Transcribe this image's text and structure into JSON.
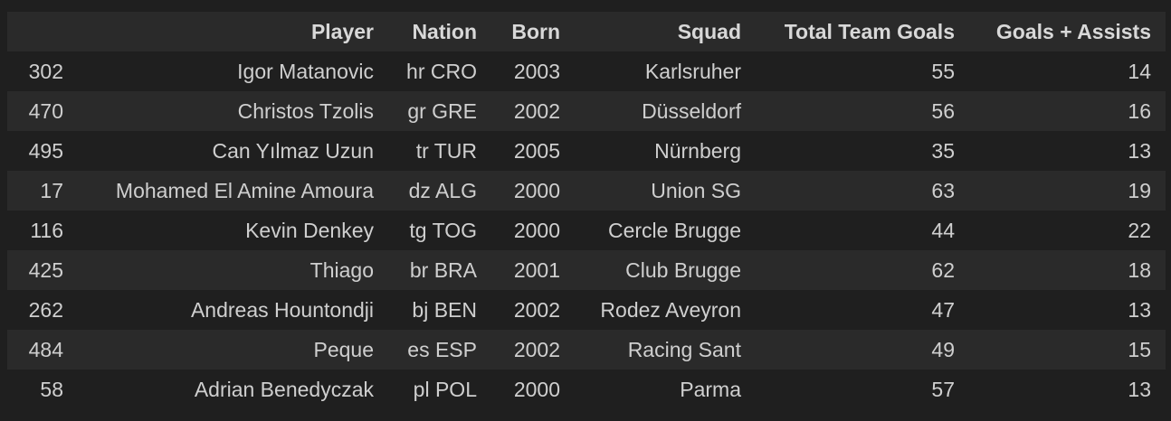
{
  "table": {
    "headers": [
      "",
      "Player",
      "Nation",
      "Born",
      "Squad",
      "Total Team Goals",
      "Goals + Assists"
    ],
    "rows": [
      [
        "302",
        "Igor Matanovic",
        "hr CRO",
        "2003",
        "Karlsruher",
        "55",
        "14"
      ],
      [
        "470",
        "Christos Tzolis",
        "gr GRE",
        "2002",
        "Düsseldorf",
        "56",
        "16"
      ],
      [
        "495",
        "Can Yılmaz Uzun",
        "tr TUR",
        "2005",
        "Nürnberg",
        "35",
        "13"
      ],
      [
        "17",
        "Mohamed El Amine Amoura",
        "dz ALG",
        "2000",
        "Union SG",
        "63",
        "19"
      ],
      [
        "116",
        "Kevin Denkey",
        "tg TOG",
        "2000",
        "Cercle Brugge",
        "44",
        "22"
      ],
      [
        "425",
        "Thiago",
        "br BRA",
        "2001",
        "Club Brugge",
        "62",
        "18"
      ],
      [
        "262",
        "Andreas Hountondji",
        "bj BEN",
        "2002",
        "Rodez Aveyron",
        "47",
        "13"
      ],
      [
        "484",
        "Peque",
        "es ESP",
        "2002",
        "Racing Sant",
        "49",
        "15"
      ],
      [
        "58",
        "Adrian Benedyczak",
        "pl POL",
        "2000",
        "Parma",
        "57",
        "13"
      ]
    ]
  }
}
